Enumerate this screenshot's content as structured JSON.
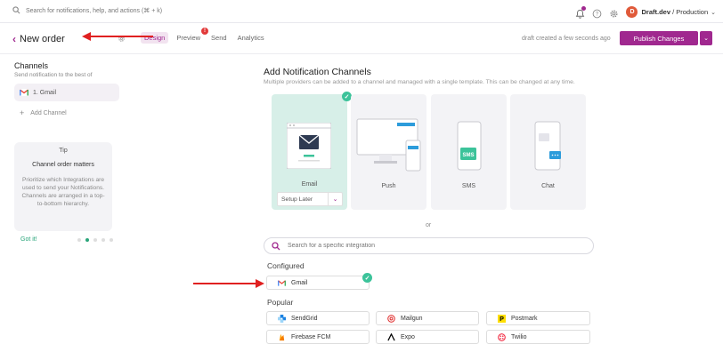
{
  "topbar": {
    "search_placeholder": "Search for notifications, help, and actions (⌘ + k)",
    "avatar_initial": "D",
    "org_name": "Draft.dev",
    "env_name": "Production"
  },
  "header": {
    "back_label": "New order",
    "tabs": [
      {
        "label": "Design"
      },
      {
        "label": "Preview",
        "badge": "!"
      },
      {
        "label": "Send"
      },
      {
        "label": "Analytics"
      }
    ],
    "draft_status": "draft created a few seconds ago",
    "publish_label": "Publish Changes"
  },
  "sidebar": {
    "title": "Channels",
    "subtitle": "Send notification to the best of",
    "channel_item": "1.  Gmail",
    "add_channel": "Add Channel",
    "tip": {
      "heading": "Tip",
      "title": "Channel order matters",
      "body": "Prioritize which Integrations are used to send your Notifications. Channels are arranged in a top-to-bottom hierarchy."
    },
    "got_it": "Got it!"
  },
  "main": {
    "title": "Add Notification Channels",
    "subtitle": "Multiple providers can be added to a channel and managed with a single template. This can be changed at any time.",
    "channels": [
      {
        "label": "Email",
        "selected": true
      },
      {
        "label": "Push"
      },
      {
        "label": "SMS"
      },
      {
        "label": "Chat"
      }
    ],
    "setup_later": "Setup Later",
    "sms_badge": "SMS",
    "or": "or",
    "integration_search_placeholder": "Search for a specific integration",
    "configured_heading": "Configured",
    "configured": [
      {
        "label": "Gmail"
      }
    ],
    "popular_heading": "Popular",
    "popular": [
      {
        "label": "SendGrid"
      },
      {
        "label": "Mailgun"
      },
      {
        "label": "Postmark"
      },
      {
        "label": "Firebase FCM"
      },
      {
        "label": "Expo"
      },
      {
        "label": "Twilio"
      }
    ]
  },
  "colors": {
    "accent": "#a0288f",
    "success": "#3cc39a",
    "annotation_arrow": "#e02020"
  }
}
